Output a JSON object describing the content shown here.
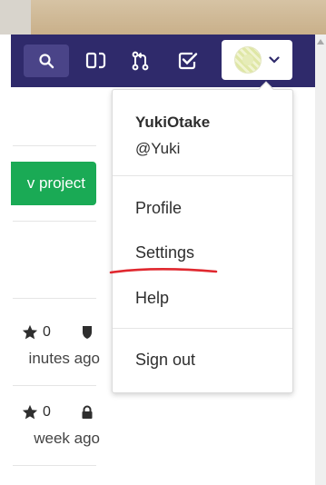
{
  "colors": {
    "navbar": "#2f2a6b",
    "search_bg": "#4a4488",
    "new_project_green": "#1aaa55",
    "annotation_red": "#e0282f"
  },
  "navbar": {
    "icons": [
      "search-icon",
      "issues-board-icon",
      "merge-request-icon",
      "todo-check-icon",
      "avatar-chevron-down-icon"
    ]
  },
  "main": {
    "new_project_label": "v project",
    "projects": [
      {
        "stars": "0",
        "visibility_icon": "shield-icon",
        "time": "inutes ago"
      },
      {
        "stars": "0",
        "visibility_icon": "lock-icon",
        "time": "week ago"
      }
    ]
  },
  "dropdown": {
    "user_name": "YukiOtake",
    "user_handle": "@Yuki",
    "items": [
      "Profile",
      "Settings",
      "Help",
      "Sign out"
    ]
  }
}
